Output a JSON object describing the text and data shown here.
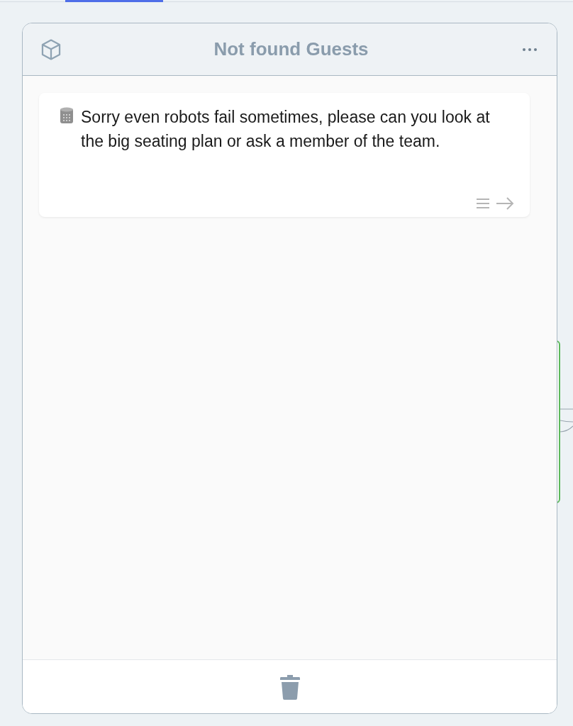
{
  "card": {
    "title": "Not found Guests"
  },
  "message": {
    "text": "Sorry even robots fail sometimes, please can you look at the big seating plan or ask a member of the team."
  }
}
